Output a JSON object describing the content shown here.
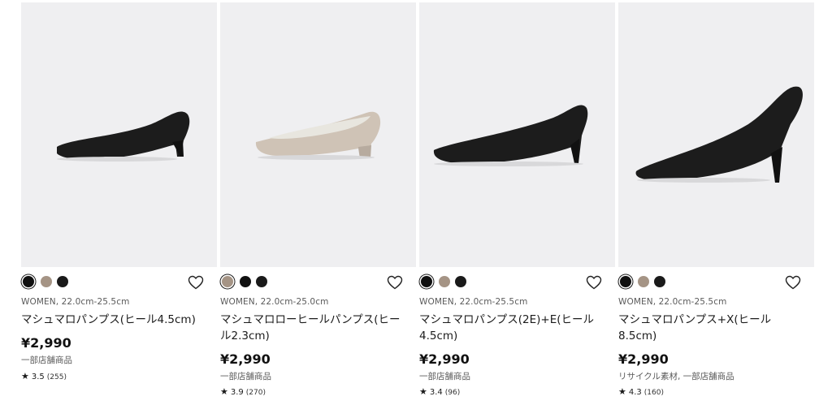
{
  "products": [
    {
      "image_alt": "black pointed pumps",
      "swatches": [
        {
          "name": "black",
          "color": "#111111",
          "selected": true
        },
        {
          "name": "beige",
          "color": "#a59485",
          "selected": false
        },
        {
          "name": "black-2",
          "color": "#1a1a1a",
          "selected": false
        }
      ],
      "meta": "WOMEN, 22.0cm-25.5cm",
      "name": "マシュマロパンプス(ヒール4.5cm)",
      "price": "¥2,990",
      "note": "一部店舗商品",
      "rating": "3.5",
      "reviews": "(255)"
    },
    {
      "image_alt": "beige low heel pumps",
      "swatches": [
        {
          "name": "beige",
          "color": "#a59485",
          "selected": true
        },
        {
          "name": "black",
          "color": "#111111",
          "selected": false
        },
        {
          "name": "black-2",
          "color": "#1a1a1a",
          "selected": false
        }
      ],
      "meta": "WOMEN, 22.0cm-25.0cm",
      "name": "マシュマロローヒールパンプス(ヒール2.3cm)",
      "price": "¥2,990",
      "note": "一部店舗商品",
      "rating": "3.9",
      "reviews": "(270)"
    },
    {
      "image_alt": "black pumps wide",
      "swatches": [
        {
          "name": "black",
          "color": "#111111",
          "selected": true
        },
        {
          "name": "beige",
          "color": "#a59485",
          "selected": false
        },
        {
          "name": "black-2",
          "color": "#1a1a1a",
          "selected": false
        }
      ],
      "meta": "WOMEN, 22.0cm-25.5cm",
      "name": "マシュマロパンプス(2E)+E(ヒール4.5cm)",
      "price": "¥2,990",
      "note": "一部店舗商品",
      "rating": "3.4",
      "reviews": "(96)"
    },
    {
      "image_alt": "black high heel pumps",
      "swatches": [
        {
          "name": "black",
          "color": "#111111",
          "selected": true
        },
        {
          "name": "beige",
          "color": "#a59485",
          "selected": false
        },
        {
          "name": "black-2",
          "color": "#1a1a1a",
          "selected": false
        }
      ],
      "meta": "WOMEN, 22.0cm-25.5cm",
      "name": "マシュマロパンプス+X(ヒール8.5cm)",
      "price": "¥2,990",
      "note": "リサイクル素材, 一部店舗商品",
      "rating": "4.3",
      "reviews": "(160)"
    }
  ],
  "icons": {
    "favorite": "heart-outline-icon",
    "star": "star-icon"
  }
}
